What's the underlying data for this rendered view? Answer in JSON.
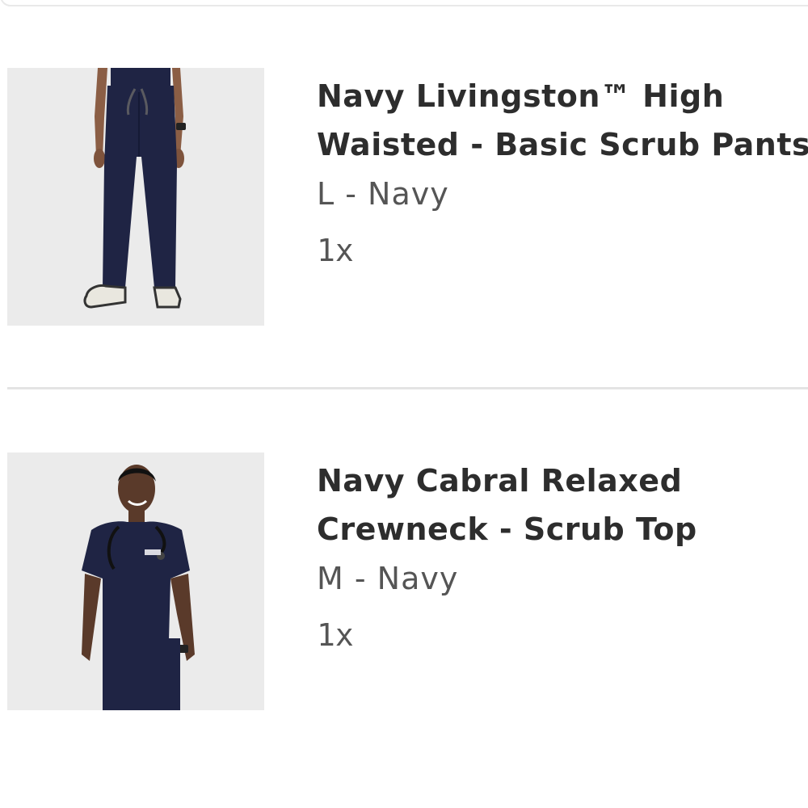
{
  "cart": {
    "items": [
      {
        "name_line1": "Navy Livingston™ High",
        "name_line2": "Waisted - Basic Scrub Pants",
        "variant": "L - Navy",
        "quantity": "1x",
        "image_icon": "scrub-pants-photo"
      },
      {
        "name_line1": "Navy Cabral Relaxed",
        "name_line2": "Crewneck - Scrub Top",
        "variant": "M - Navy",
        "quantity": "1x",
        "image_icon": "scrub-top-photo"
      }
    ]
  },
  "colors": {
    "navy": "#1f2444",
    "text": "#2d2d2d",
    "muted": "#555555"
  }
}
